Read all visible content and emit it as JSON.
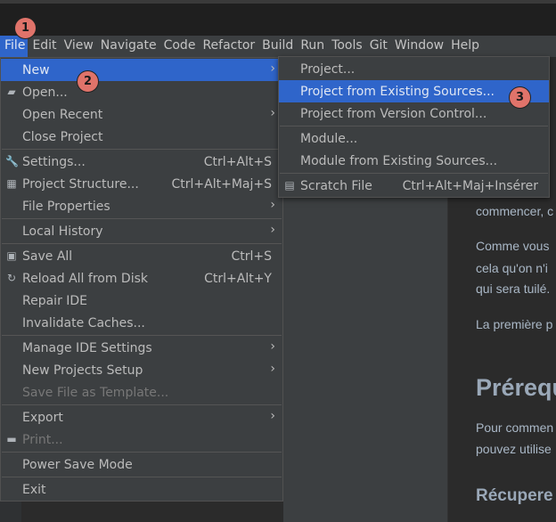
{
  "menubar": [
    {
      "label": "File",
      "u": "F",
      "active": true
    },
    {
      "label": "Edit",
      "u": "E"
    },
    {
      "label": "View",
      "u": "V"
    },
    {
      "label": "Navigate",
      "u": "N"
    },
    {
      "label": "Code",
      "u": "C"
    },
    {
      "label": "Refactor",
      "u": "R"
    },
    {
      "label": "Build",
      "u": "B"
    },
    {
      "label": "Run",
      "u": "u"
    },
    {
      "label": "Tools",
      "u": "T"
    },
    {
      "label": "Git",
      "u": "G"
    },
    {
      "label": "Window",
      "u": "W"
    },
    {
      "label": "Help",
      "u": "H"
    }
  ],
  "file_menu": [
    {
      "label": "New",
      "submenu": true,
      "selected": true
    },
    {
      "label": "Open...",
      "icon": "folder-open-icon"
    },
    {
      "label": "Open Recent",
      "submenu": true
    },
    {
      "label": "Close Project"
    },
    {
      "sep": true
    },
    {
      "label": "Settings...",
      "shortcut": "Ctrl+Alt+S",
      "icon": "wrench-icon"
    },
    {
      "label": "Project Structure...",
      "shortcut": "Ctrl+Alt+Maj+S",
      "icon": "project-structure-icon"
    },
    {
      "label": "File Properties",
      "submenu": true
    },
    {
      "sep": true
    },
    {
      "label": "Local History",
      "submenu": true
    },
    {
      "sep": true
    },
    {
      "label": "Save All",
      "shortcut": "Ctrl+S",
      "icon": "save-icon"
    },
    {
      "label": "Reload All from Disk",
      "shortcut": "Ctrl+Alt+Y",
      "icon": "reload-icon"
    },
    {
      "label": "Repair IDE"
    },
    {
      "label": "Invalidate Caches..."
    },
    {
      "sep": true
    },
    {
      "label": "Manage IDE Settings",
      "submenu": true
    },
    {
      "label": "New Projects Setup",
      "submenu": true
    },
    {
      "label": "Save File as Template...",
      "disabled": true
    },
    {
      "sep": true
    },
    {
      "label": "Export",
      "submenu": true
    },
    {
      "label": "Print...",
      "disabled": true,
      "icon": "print-icon"
    },
    {
      "sep": true
    },
    {
      "label": "Power Save Mode"
    },
    {
      "sep": true
    },
    {
      "label": "Exit"
    }
  ],
  "new_submenu": [
    {
      "label": "Project..."
    },
    {
      "label": "Project from Existing Sources...",
      "selected": true
    },
    {
      "label": "Project from Version Control..."
    },
    {
      "sep": true
    },
    {
      "label": "Module..."
    },
    {
      "label": "Module from Existing Sources..."
    },
    {
      "sep": true
    },
    {
      "label": "Scratch File",
      "shortcut": "Ctrl+Alt+Maj+Insérer",
      "icon": "scratch-file-icon"
    }
  ],
  "badges": [
    "1",
    "2",
    "3"
  ],
  "badge_color": "#e0736a",
  "accent": "#2f65ca",
  "tab_fragment": "d",
  "editor": {
    "lines": [
      "commencer, c",
      "Comme vous",
      "cela qu'on n'i",
      "qui sera tuilé.",
      "La première p",
      "Pour commen",
      "pouvez utilise"
    ],
    "heading1": "Prérequ",
    "heading2": "Récupere"
  }
}
